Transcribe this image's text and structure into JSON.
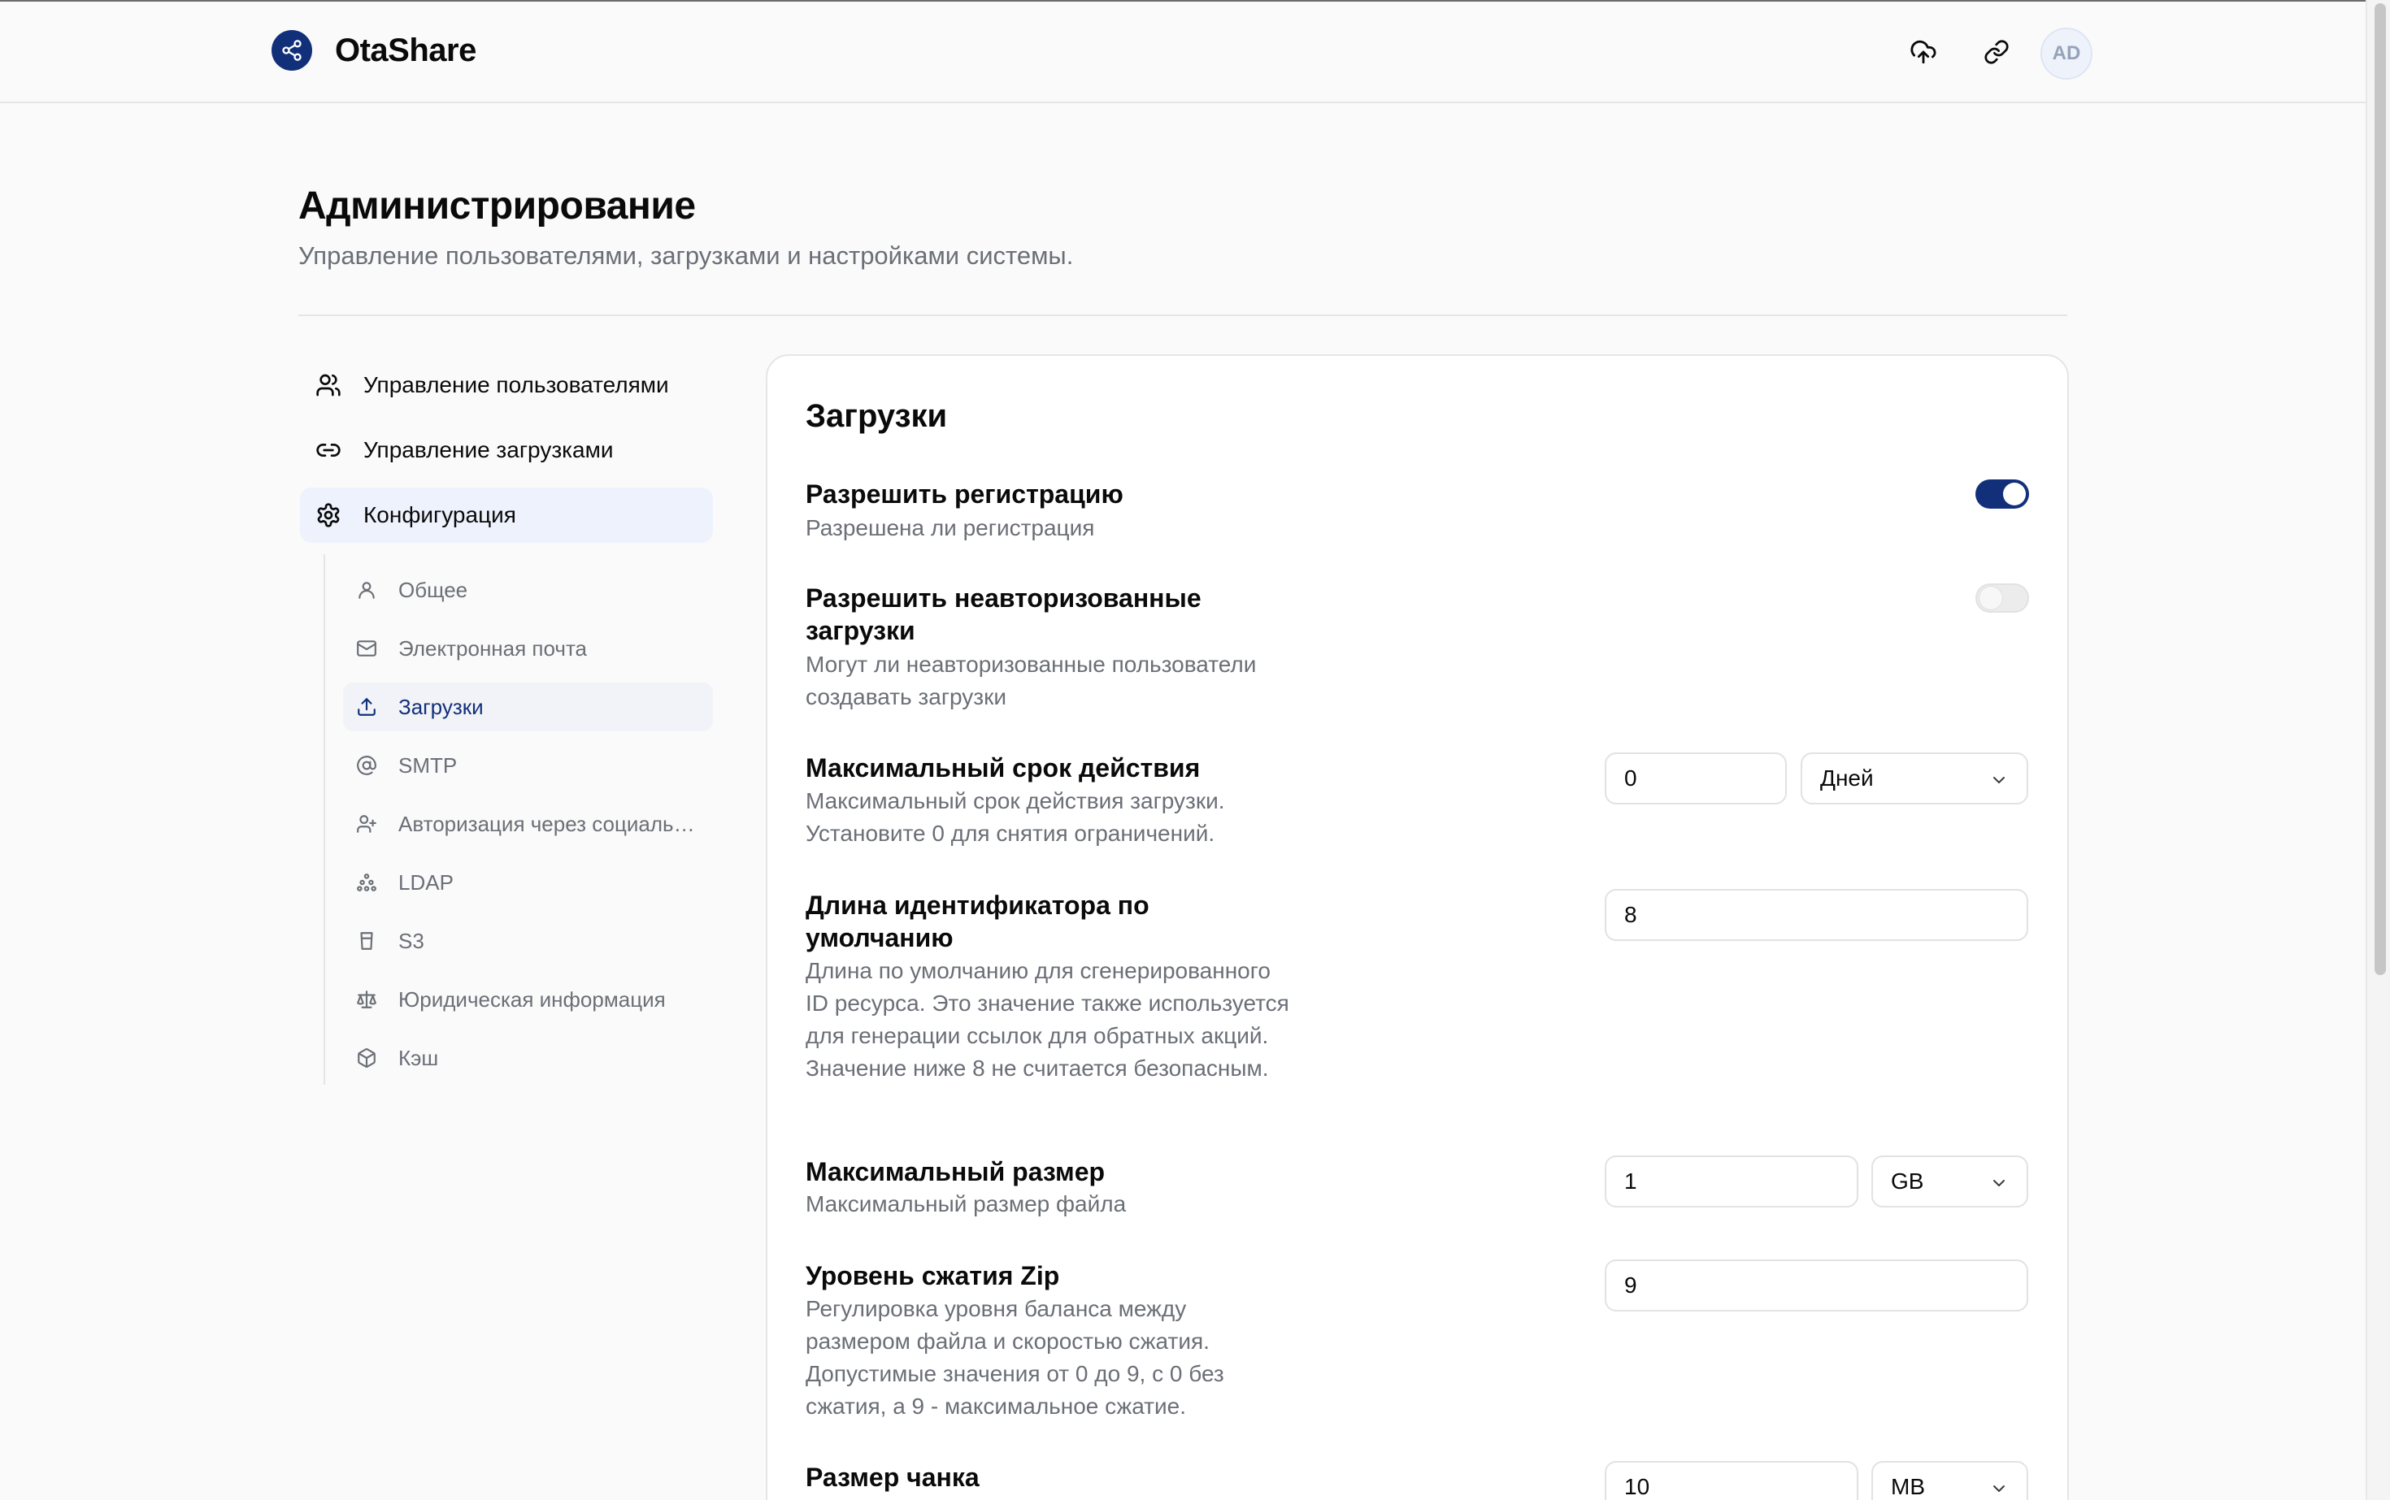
{
  "app": {
    "name": "OtaShare",
    "avatar_initials": "AD"
  },
  "header": {
    "icons": [
      "share-icon",
      "upload-cloud-icon",
      "link-icon"
    ]
  },
  "page": {
    "title": "Администрирование",
    "subtitle": "Управление пользователями, загрузками и настройками системы."
  },
  "sidebar": {
    "items": [
      {
        "label": "Управление пользователями",
        "icon": "users-icon"
      },
      {
        "label": "Управление загрузками",
        "icon": "link-icon"
      },
      {
        "label": "Конфигурация",
        "icon": "gear-icon",
        "active": true
      }
    ],
    "sub_items": [
      {
        "label": "Общее",
        "icon": "user-icon"
      },
      {
        "label": "Электронная почта",
        "icon": "mail-icon"
      },
      {
        "label": "Загрузки",
        "icon": "upload-icon",
        "active": true
      },
      {
        "label": "SMTP",
        "icon": "at-icon"
      },
      {
        "label": "Авторизация через социальные сети",
        "icon": "users-icon"
      },
      {
        "label": "LDAP",
        "icon": "network-icon"
      },
      {
        "label": "S3",
        "icon": "bucket-icon"
      },
      {
        "label": "Юридическая информация",
        "icon": "scale-icon"
      },
      {
        "label": "Кэш",
        "icon": "box-icon"
      }
    ]
  },
  "card": {
    "title": "Загрузки",
    "settings": {
      "allow_registration": {
        "title": "Разрешить регистрацию",
        "desc": "Разрешена ли регистрация",
        "enabled": true
      },
      "allow_unauth": {
        "title": "Разрешить неавторизованные загрузки",
        "desc": "Могут ли неавторизованные пользователи создавать загрузки",
        "enabled": false
      },
      "max_expiration": {
        "title": "Максимальный срок действия",
        "desc": "Максимальный срок действия загрузки. Установите 0 для снятия ограничений.",
        "value": "0",
        "unit": "Дней"
      },
      "id_length": {
        "title": "Длина идентификатора по умолчанию",
        "desc": "Длина по умолчанию для сгенерированного ID ресурса. Это значение также используется для генерации ссылок для обратных акций. Значение ниже 8 не считается безопасным.",
        "value": "8"
      },
      "max_size": {
        "title": "Максимальный размер",
        "desc": "Максимальный размер файла",
        "value": "1",
        "unit": "GB"
      },
      "zip_level": {
        "title": "Уровень сжатия Zip",
        "desc": "Регулировка уровня баланса между размером файла и скоростью сжатия. Допустимые значения от 0 до 9, с 0 без сжатия, а 9 - максимальное сжатие.",
        "value": "9"
      },
      "chunk_size": {
        "title": "Размер чанка",
        "value": "10",
        "unit": "MB"
      }
    }
  },
  "colors": {
    "accent": "#12307a",
    "muted_text": "#6b6f76",
    "border": "#e5e5e5"
  }
}
